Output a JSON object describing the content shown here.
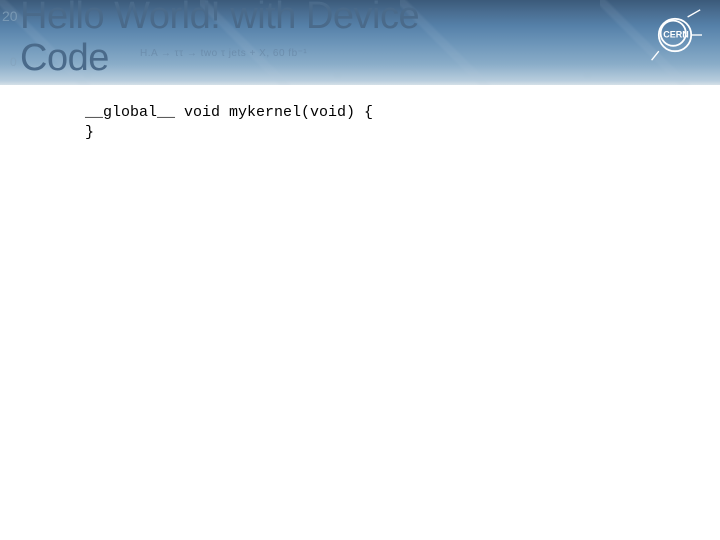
{
  "title_line1": "Hello World! with Device",
  "title_line2": "Code",
  "logo_text": "CERN",
  "code": {
    "line1_global": "__global__ ",
    "line1_rest": "void mykernel(void) {",
    "line2": "}"
  },
  "bg": {
    "formula": "H.A → ττ → two τ jets + X, 60 fb⁻¹",
    "num1": "20",
    "num2": "0"
  }
}
